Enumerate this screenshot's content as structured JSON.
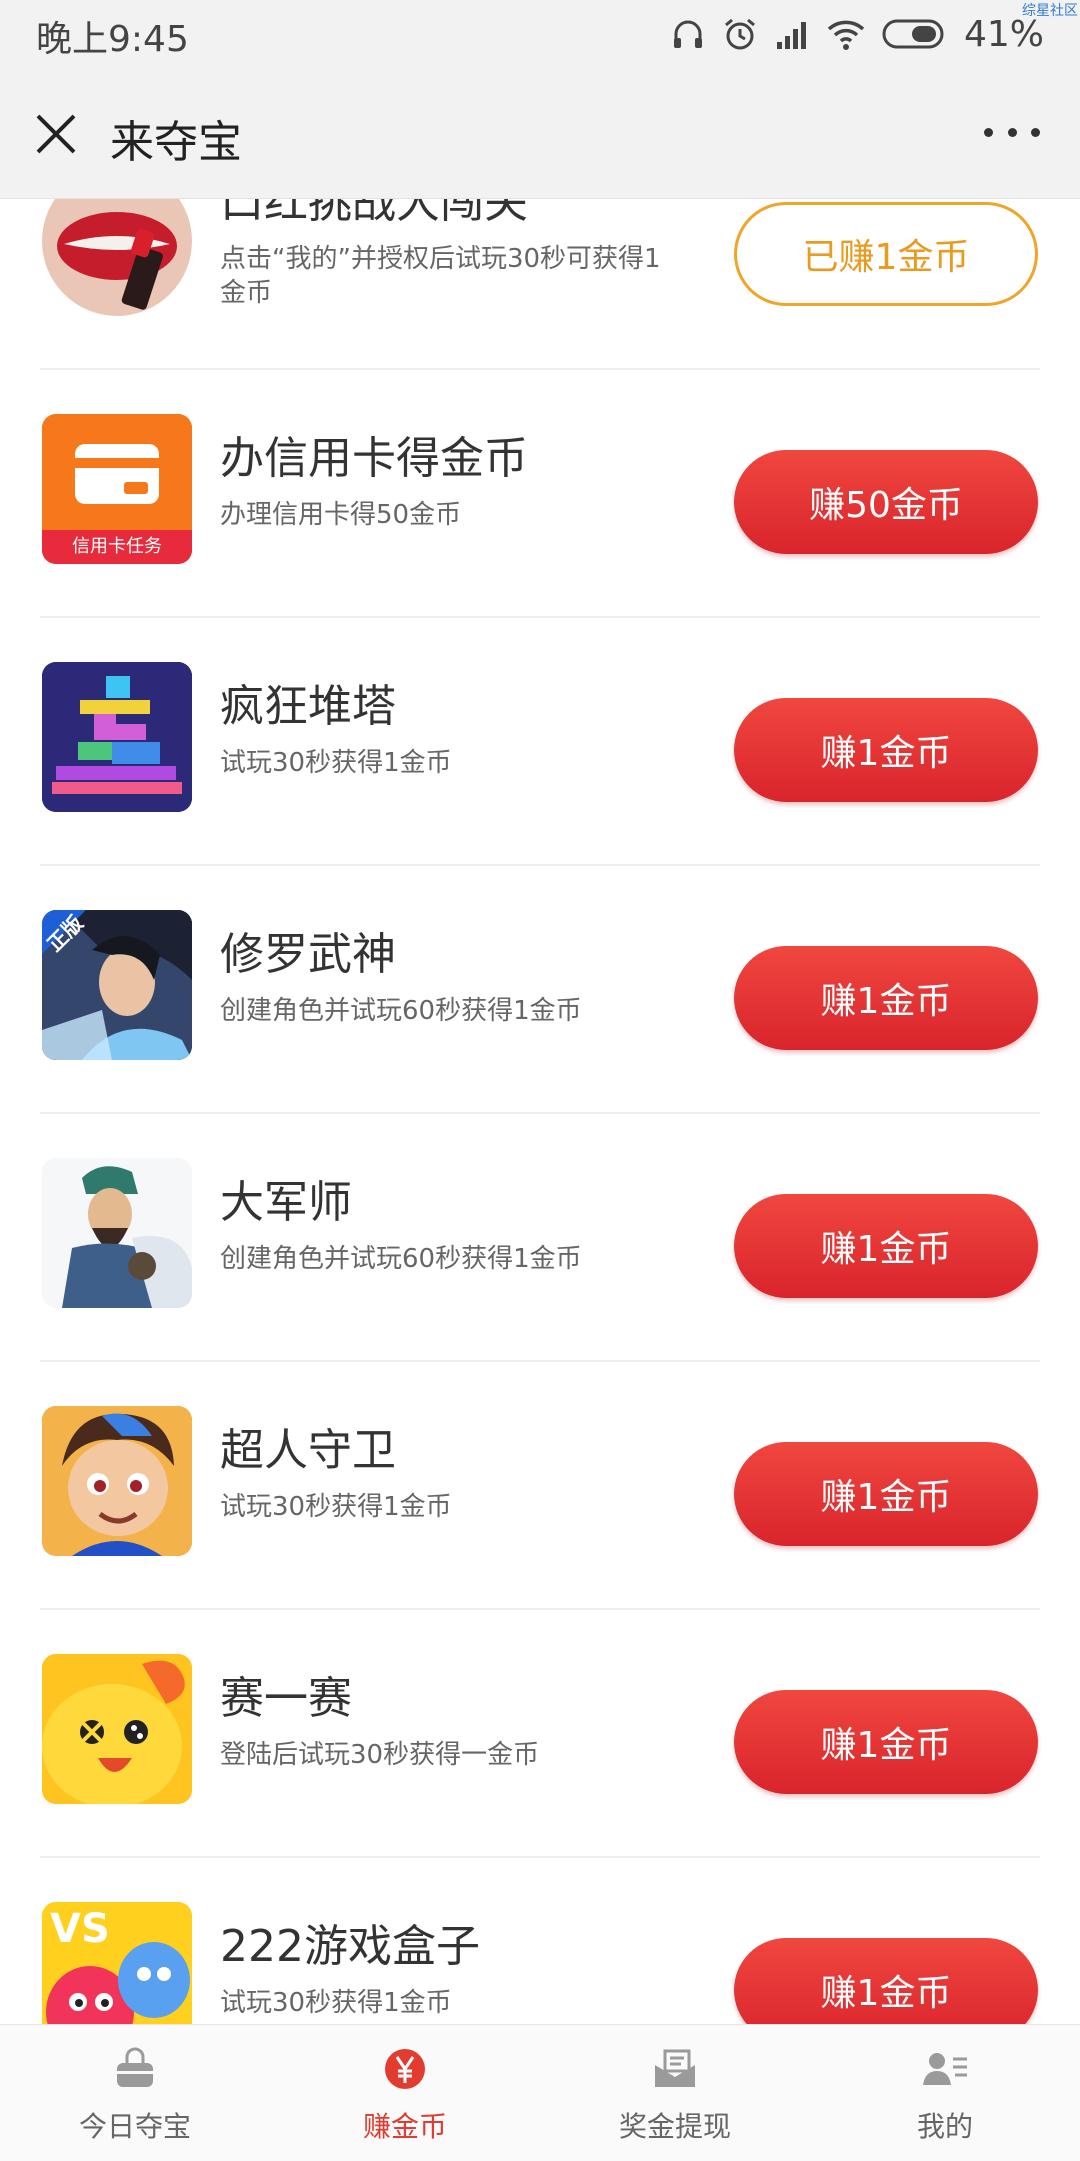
{
  "status_bar": {
    "time": "晚上9:45",
    "battery": "41%",
    "watermark": "综星社区"
  },
  "header": {
    "title": "来夺宝"
  },
  "tasks": [
    {
      "name": "口红挑战大闯关",
      "desc": "点击“我的”并授权后试玩30秒可获得1金币",
      "button": "已赚1金币",
      "done": true,
      "icon": "lipstick-icon"
    },
    {
      "name": "办信用卡得金币",
      "desc": "办理信用卡得50金币",
      "button": "赚50金币",
      "done": false,
      "icon": "credit-card-icon",
      "badge": "信用卡任务"
    },
    {
      "name": "疯狂堆塔",
      "desc": "试玩30秒获得1金币",
      "button": "赚1金币",
      "done": false,
      "icon": "tower-stack-game-icon"
    },
    {
      "name": "修罗武神",
      "desc": "创建角色并试玩60秒获得1金币",
      "button": "赚1金币",
      "done": false,
      "icon": "warrior-game-icon",
      "badge": "正版"
    },
    {
      "name": "大军师",
      "desc": "创建角色并试玩60秒获得1金币",
      "button": "赚1金币",
      "done": false,
      "icon": "strategist-game-icon"
    },
    {
      "name": "超人守卫",
      "desc": "试玩30秒获得1金币",
      "button": "赚1金币",
      "done": false,
      "icon": "superhero-game-icon"
    },
    {
      "name": "赛一赛",
      "desc": "登陆后试玩30秒获得一金币",
      "button": "赚1金币",
      "done": false,
      "icon": "chick-game-icon"
    },
    {
      "name": "222游戏盒子",
      "desc": "试玩30秒获得1金币",
      "button": "赚1金币",
      "done": false,
      "icon": "game-box-icon",
      "badge": "VS"
    }
  ],
  "tabs": [
    {
      "label": "今日夺宝",
      "icon": "shopping-bag-icon",
      "active": false
    },
    {
      "label": "赚金币",
      "icon": "yen-coin-icon",
      "active": true
    },
    {
      "label": "奖金提现",
      "icon": "wallet-icon",
      "active": false
    },
    {
      "label": "我的",
      "icon": "profile-card-icon",
      "active": false
    }
  ],
  "colors": {
    "accent_red": "#e23b30",
    "done_orange": "#ea9a1f"
  }
}
